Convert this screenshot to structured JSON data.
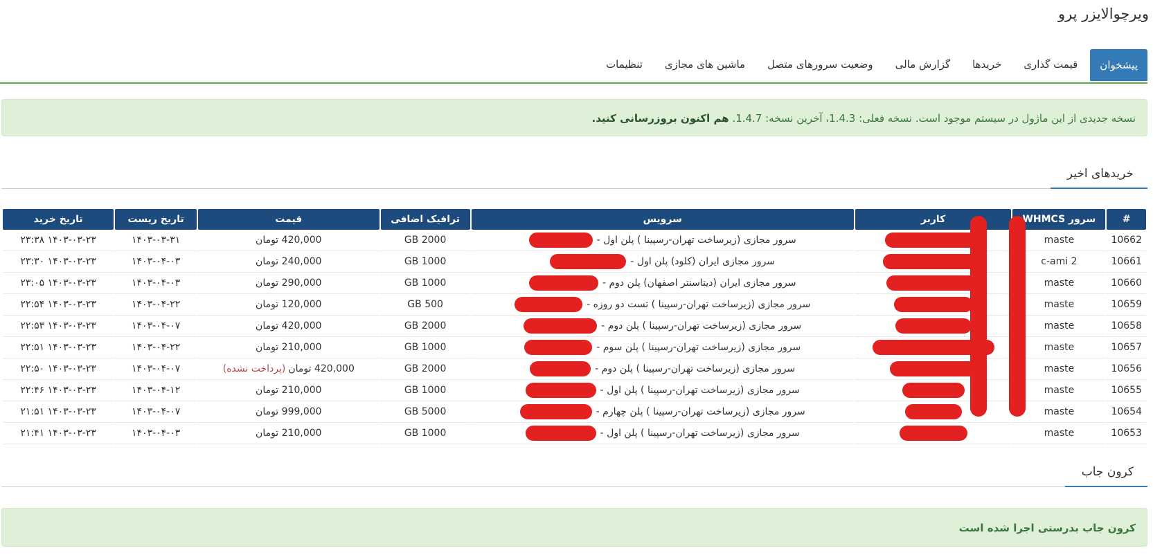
{
  "app": {
    "title": "ویرچوالایزر پرو"
  },
  "tabs": [
    {
      "label": "پیشخوان",
      "active": true
    },
    {
      "label": "قیمت گذاری",
      "active": false
    },
    {
      "label": "خریدها",
      "active": false
    },
    {
      "label": "گزارش مالی",
      "active": false
    },
    {
      "label": "وضعیت سرورهای متصل",
      "active": false
    },
    {
      "label": "ماشین های مجازی",
      "active": false
    },
    {
      "label": "تنظیمات",
      "active": false
    }
  ],
  "update_notice": {
    "text": "نسخه جدیدی از این ماژول در سیستم موجود است. نسخه فعلی: 1.4.3، آخرین نسخه: 1.4.7.",
    "action": "هم اکنون بروزرسانی کنید."
  },
  "recent_section": {
    "title": "خریدهای اخیر"
  },
  "table": {
    "headers": [
      "#",
      "سرور WHMCS",
      "کاربر",
      "سرویس",
      "ترافیک اضافی",
      "قیمت",
      "تاریخ ریست",
      "تاریخ خرید"
    ],
    "rows": [
      {
        "id": "10662",
        "server": "maste",
        "service": "سرور مجازی (زیرساخت تهران-رسپینا ) پلن اول -",
        "traffic": "2000 GB",
        "price": "420,000 تومان",
        "unpaid": "",
        "reset": "۱۴۰۳-۰۳-۳۱",
        "date": "۱۴۰۳-۰۳-۲۳ ۲۳:۳۸"
      },
      {
        "id": "10661",
        "server": "c-ami 2",
        "service": "سرور مجازی ایران (کلود) پلن اول -",
        "traffic": "1000 GB",
        "price": "240,000 تومان",
        "unpaid": "",
        "reset": "۱۴۰۳-۰۴-۰۳",
        "date": "۱۴۰۳-۰۳-۲۳ ۲۳:۳۰"
      },
      {
        "id": "10660",
        "server": "maste",
        "service": "سرور مجازی ایران (دیتاسنتر اصفهان) پلن دوم -",
        "traffic": "1000 GB",
        "price": "290,000 تومان",
        "unpaid": "",
        "reset": "۱۴۰۳-۰۴-۰۳",
        "date": "۱۴۰۳-۰۳-۲۳ ۲۳:۰۵"
      },
      {
        "id": "10659",
        "server": "maste",
        "service": "سرور مجازی (زیرساخت تهران-رسپینا ) تست دو روزه -",
        "traffic": "500 GB",
        "price": "120,000 تومان",
        "unpaid": "",
        "reset": "۱۴۰۳-۰۴-۲۲",
        "date": "۱۴۰۳-۰۳-۲۳ ۲۲:۵۴"
      },
      {
        "id": "10658",
        "server": "maste",
        "service": "سرور مجازی (زیرساخت تهران-رسپینا ) پلن دوم -",
        "traffic": "2000 GB",
        "price": "420,000 تومان",
        "unpaid": "",
        "reset": "۱۴۰۳-۰۴-۰۷",
        "date": "۱۴۰۳-۰۳-۲۳ ۲۲:۵۳"
      },
      {
        "id": "10657",
        "server": "maste",
        "service": "سرور مجازی (زیرساخت تهران-رسپینا ) پلن سوم -",
        "traffic": "1000 GB",
        "price": "210,000 تومان",
        "unpaid": "",
        "reset": "۱۴۰۳-۰۴-۲۲",
        "date": "۱۴۰۳-۰۳-۲۳ ۲۲:۵۱"
      },
      {
        "id": "10656",
        "server": "maste",
        "service": "سرور مجازی (زیرساخت تهران-رسپینا ) پلن دوم -",
        "traffic": "2000 GB",
        "price": "420,000 تومان",
        "unpaid": "(پرداخت نشده)",
        "reset": "۱۴۰۳-۰۴-۰۷",
        "date": "۱۴۰۳-۰۳-۲۳ ۲۲:۵۰"
      },
      {
        "id": "10655",
        "server": "maste",
        "service": "سرور مجازی (زیرساخت تهران-رسپینا ) پلن اول -",
        "traffic": "1000 GB",
        "price": "210,000 تومان",
        "unpaid": "",
        "reset": "۱۴۰۳-۰۴-۱۲",
        "date": "۱۴۰۳-۰۳-۲۳ ۲۲:۴۶"
      },
      {
        "id": "10654",
        "server": "maste",
        "service": "سرور مجازی (زیرساخت تهران-رسپینا ) پلن چهارم -",
        "traffic": "5000 GB",
        "price": "999,000 تومان",
        "unpaid": "",
        "reset": "۱۴۰۳-۰۴-۰۷",
        "date": "۱۴۰۳-۰۳-۲۳ ۲۱:۵۱"
      },
      {
        "id": "10653",
        "server": "maste",
        "service": "سرور مجازی (زیرساخت تهران-رسپینا ) پلن اول -",
        "traffic": "1000 GB",
        "price": "210,000 تومان",
        "unpaid": "",
        "reset": "۱۴۰۳-۰۴-۰۳",
        "date": "۱۴۰۳-۰۳-۲۳ ۲۱:۴۱"
      }
    ]
  },
  "cron_section": {
    "title": "کرون جاب"
  },
  "cron_notice": {
    "text": "کرون جاب بدرستی اجرا شده است"
  },
  "colors": {
    "primary": "#337ab7",
    "header": "#1d4b7e",
    "success_bg": "#dff0d8",
    "success_text": "#3c763d",
    "tab_line": "#5aab47",
    "redaction": "#e32121"
  }
}
